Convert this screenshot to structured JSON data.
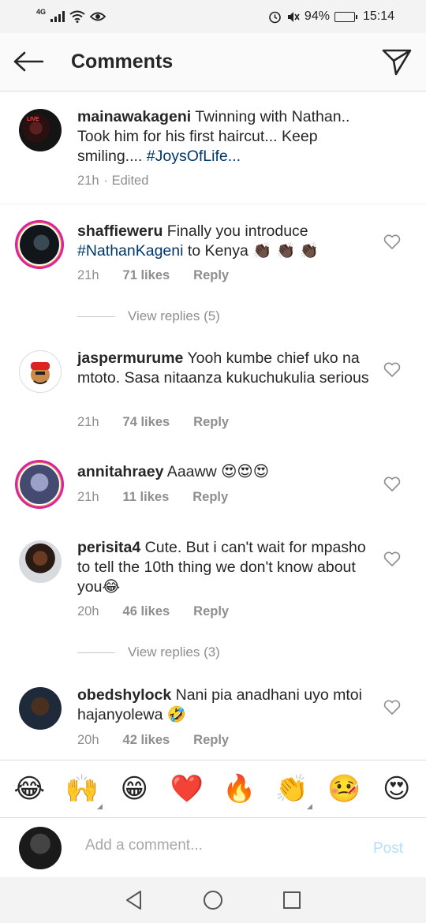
{
  "status_bar": {
    "network": "4G",
    "battery": "94%",
    "time": "15:14"
  },
  "header": {
    "title": "Comments"
  },
  "caption": {
    "username": "mainawakageni",
    "text": " Twinning with Nathan.. Took him for his first haircut... Keep smiling.... ",
    "hashtag": "#JoysOfLife",
    "suffix": "...",
    "time": "21h",
    "edited": "· Edited",
    "avatar_badge": "LIVE"
  },
  "comments": [
    {
      "username": "shaffieweru",
      "text_before": " Finally you introduce ",
      "hashtag": "#NathanKageni",
      "text_after": " to Kenya 👏🏿 👏🏿 👏🏿",
      "time": "21h",
      "likes": "71 likes",
      "reply": "Reply",
      "view_replies": "View replies (5)"
    },
    {
      "username": "jaspermurume",
      "text": " Yooh kumbe chief uko na mtoto. Sasa nitaanza kukuchukulia serious",
      "time": "21h",
      "likes": "74 likes",
      "reply": "Reply"
    },
    {
      "username": "annitahraey",
      "text": " Aaaww 😍😍😍",
      "time": "21h",
      "likes": "11 likes",
      "reply": "Reply"
    },
    {
      "username": "perisita4",
      "text": " Cute. But i can't wait for mpasho to tell the 10th thing we don't know about you😂",
      "time": "20h",
      "likes": "46 likes",
      "reply": "Reply",
      "view_replies": "View replies (3)"
    },
    {
      "username": "obedshylock",
      "text": " Nani pia anadhani uyo mtoi hajanyolewa 🤣",
      "time": "20h",
      "likes": "42 likes",
      "reply": "Reply"
    }
  ],
  "emoji_bar": [
    "😂",
    "🙌",
    "😁",
    "❤️",
    "🔥",
    "👏",
    "🤒",
    "😍"
  ],
  "composer": {
    "placeholder": "Add a comment...",
    "post_label": "Post"
  },
  "colors": {
    "hashtag": "#00376b",
    "muted": "#8e8e8e",
    "post_disabled": "#b2dffc",
    "story_ring": "#d6249f"
  }
}
